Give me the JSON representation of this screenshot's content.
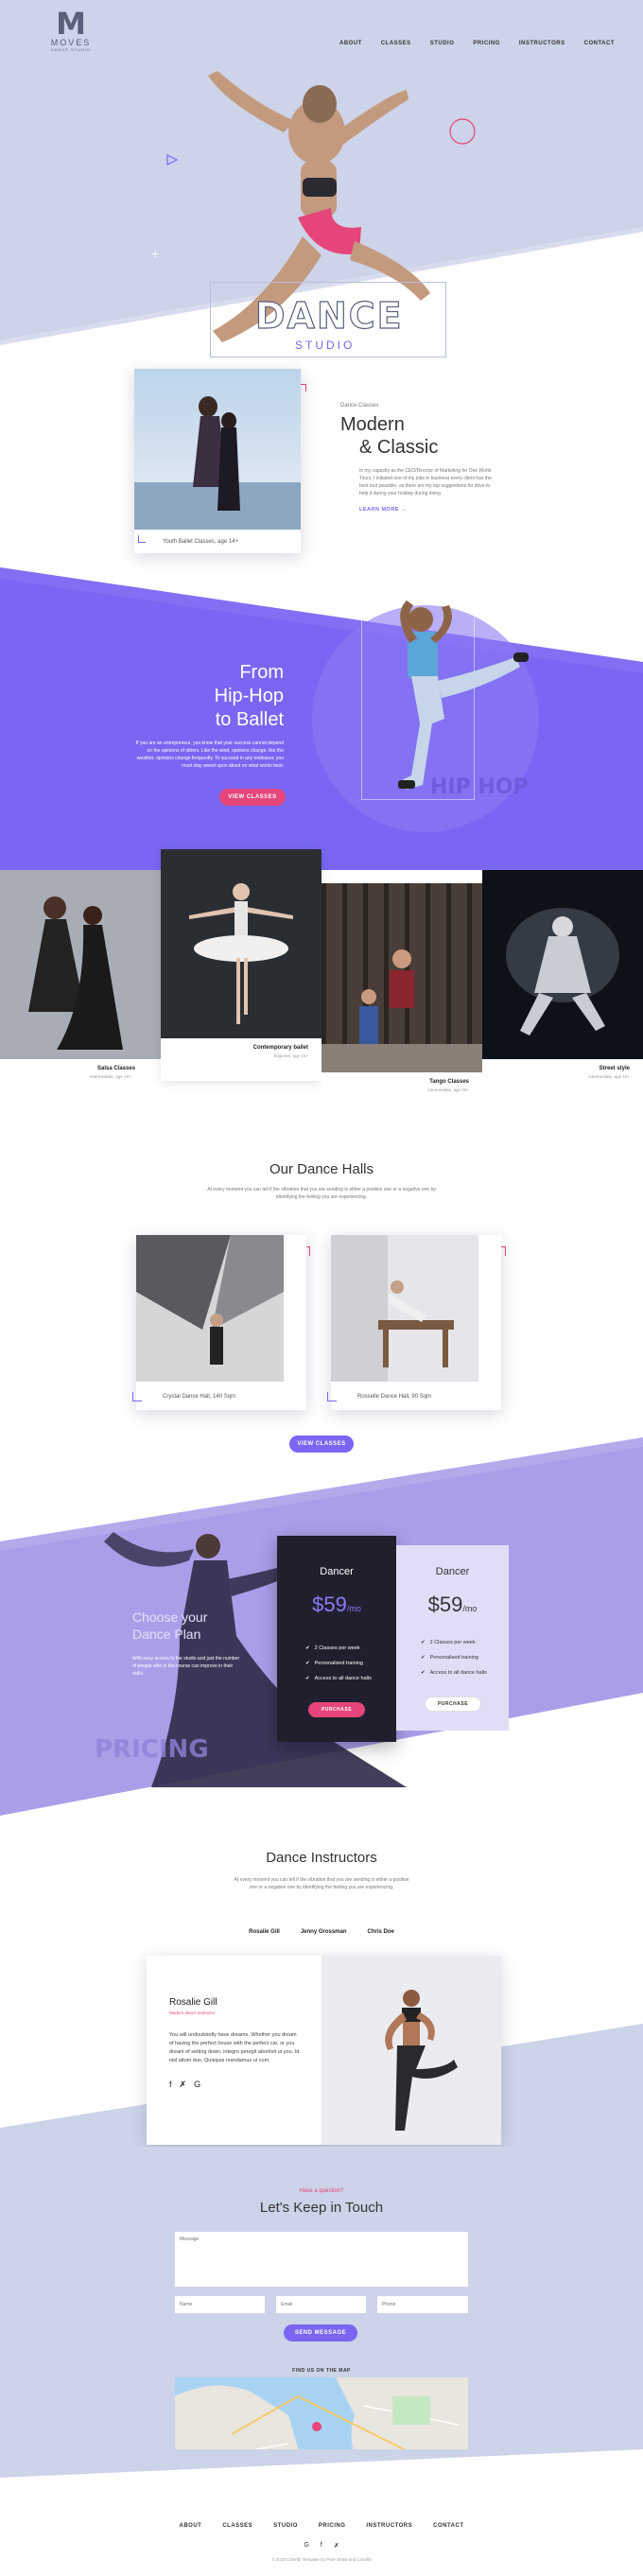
{
  "brand": {
    "mark": "M",
    "name": "MOVES",
    "sub": "DANCE STUDIO"
  },
  "nav": [
    "ABOUT",
    "CLASSES",
    "STUDIO",
    "PRICING",
    "INSTRUCTORS",
    "CONTACT"
  ],
  "hero": {
    "title": "DANCE",
    "subtitle": "STUDIO"
  },
  "modern": {
    "kicker": "Dance Classes",
    "title1": "Modern",
    "title2": "& Classic",
    "body": "In my capacity as the CEO/Director of Marketing for One World Tours, I initiated one of my jobs in business every client has the best tour possible, as there are my top suggestions for drive to help it during your holiday during doing",
    "link": "LEARN MORE",
    "caption": "Youth Ballet Classes, age 14+"
  },
  "hiphop": {
    "line1": "From",
    "line2": "Hip-Hop",
    "line3": "to Ballet",
    "body": "If you are an entrepreneur, you know that your success cannot depend on the opinions of others. Like the wind, opinions change. like the weather, opinions change frequently. To succeed in any endeavor, you must stay sweet upon about on what works best.",
    "button": "VIEW CLASSES",
    "watermark": "HIP HOP"
  },
  "classes": [
    {
      "name": "Salsa Classes",
      "sub": "intermediate, age 18+"
    },
    {
      "name": "Contemporary ballet",
      "sub": "beginner, age 16+"
    },
    {
      "name": "Tango Classes",
      "sub": "intermediate, age 20+"
    },
    {
      "name": "Street style",
      "sub": "intermediate, age 16+"
    }
  ],
  "halls": {
    "title": "Our Dance Halls",
    "body": "At every moment you can tell if the vibration that you are sending is either a positive one or a negative one by identifying the feeling you are experiencing.",
    "items": [
      {
        "caption": "Crystal Dance Hall, 140 Sqm"
      },
      {
        "caption": "Rosselle Dance Hall, 90 Sqm"
      }
    ],
    "button": "VIEW CLASSES"
  },
  "pricing": {
    "line1": "Choose your",
    "line2": "Dance Plan",
    "body": "With easy access to the studio and just the number of people who in the course can improve in their skills.",
    "watermark": "PRICING",
    "plans": [
      {
        "name": "Dancer",
        "price": "$59",
        "per": "/mo",
        "features": [
          "2 Classes per week",
          "Personalised training",
          "Access to all dance halls"
        ],
        "button": "PURCHASE"
      },
      {
        "name": "Dancer",
        "price": "$59",
        "per": "/mo",
        "features": [
          "2 Classes per week",
          "Personalised training",
          "Access to all dance halls"
        ],
        "button": "PURCHASE"
      }
    ]
  },
  "instructors": {
    "title": "Dance Instructors",
    "body": "At every moment you can tell if the vibration that you are sending is either a positive one or a negative one by identifying the feeling you are experiencing.",
    "tabs": [
      "Rosalie Gill",
      "Jenny Grossman",
      "Chris Doe"
    ],
    "card": {
      "name": "Rosalie Gill",
      "role": "Modern dance instructor",
      "bio": "You will undoubtedly have dreams. Whether you dream of having the perfect house with the perfect car, or you dream of setting down, integro peregit abortivit ut you. Id nisl altum duo. Quisquis mandamus ut cum."
    }
  },
  "contact": {
    "kicker": "Have a question?",
    "title": "Let's Keep in Touch",
    "message_placeholder": "Message",
    "name_placeholder": "Name",
    "email_placeholder": "Email",
    "phone_placeholder": "Phone",
    "button": "SEND MESSAGE",
    "map_label": "FIND US ON THE MAP"
  },
  "footer": {
    "nav": [
      "ABOUT",
      "CLASSES",
      "STUDIO",
      "PRICING",
      "INSTRUCTORS",
      "CONTACT"
    ],
    "copyright": "© 2018 Colorlib Template by Pixie Show and Colorlib"
  },
  "colors": {
    "accent": "#7a66f2",
    "pink": "#e5457a",
    "navy": "#1f1f2e",
    "lavender": "#cdd3e8"
  }
}
